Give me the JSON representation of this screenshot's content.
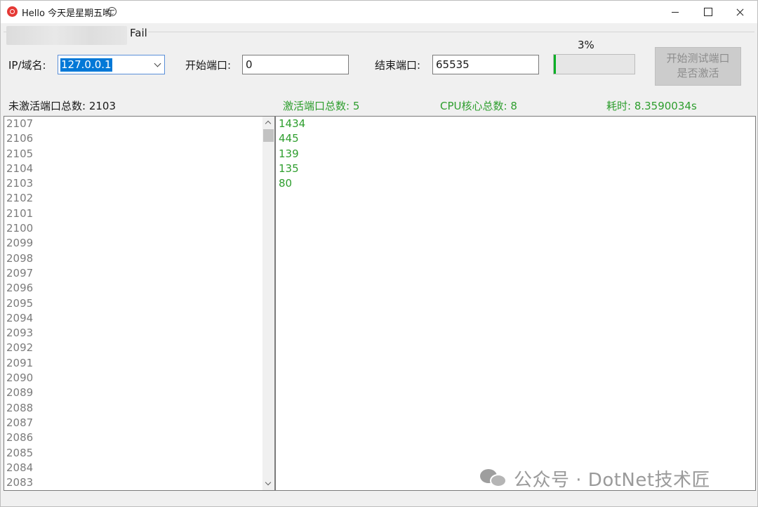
{
  "window": {
    "title": "Hello 今天是星期五哟"
  },
  "group": {
    "title": "Fail"
  },
  "form": {
    "ip_label": "IP/域名:",
    "ip_value": "127.0.0.1",
    "start_port_label": "开始端口:",
    "start_port_value": "0",
    "end_port_label": "结束端口:",
    "end_port_value": "65535",
    "progress_text": "3%",
    "progress_fraction": 0.03,
    "start_button_label_line1": "开始测试端口",
    "start_button_label_line2": "是否激活"
  },
  "stats": {
    "inactive_total": "未激活端口总数: 2103",
    "active_total": "激活端口总数: 5",
    "cpu_cores": "CPU核心总数: 8",
    "elapsed": "耗时: 8.3590034s"
  },
  "inactive_ports": [
    "2107",
    "2106",
    "2105",
    "2104",
    "2103",
    "2102",
    "2101",
    "2100",
    "2099",
    "2098",
    "2097",
    "2096",
    "2095",
    "2094",
    "2093",
    "2092",
    "2091",
    "2090",
    "2089",
    "2088",
    "2087",
    "2086",
    "2085",
    "2084",
    "2083"
  ],
  "active_ports": [
    "1434",
    "445",
    "139",
    "135",
    "80"
  ],
  "watermark": {
    "text": "公众号 · DotNet技术匠"
  },
  "colors": {
    "accent_green": "#2e9e2e",
    "progress_green": "#06b025",
    "selection_blue": "#0078d7"
  },
  "icons": [
    "app-icon",
    "emoji-icon",
    "minimize-icon",
    "maximize-icon",
    "close-icon",
    "chevron-down-icon",
    "scroll-up-icon",
    "scroll-down-icon",
    "wechat-icon"
  ]
}
